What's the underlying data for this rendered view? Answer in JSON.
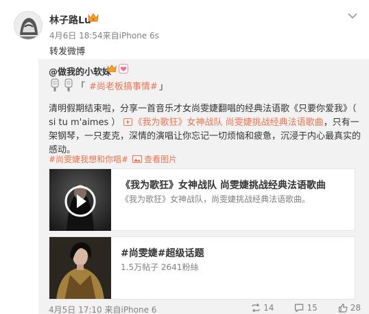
{
  "post": {
    "username": "林子路Lu",
    "meta": "4月6日 18:54来自iPhone 6s",
    "text": "转发微博"
  },
  "original": {
    "author": "@做我的小软妹",
    "hashtag": "#尚老板搞事情#",
    "bracket_open": "「",
    "bracket_close": "」",
    "body_part1": "清明假期结束啦，分享一首音乐才女尚雯婕翻唱的经典法语歌《只要你爱我》（ si tu m'aimes ）",
    "video_link": "《我为歌狂》女神战队 尚雯婕挑战经典法语歌曲",
    "body_part2": "，只有一架钢琴，一只麦克，深情的演唱让你忘记一切烦恼和疲惫，沉浸于内心最真实的感动。",
    "topic": "#尚雯婕我想和你唱#",
    "pic_link": "查看图片",
    "meta": "4月5日 17:10 来自iPhone 6",
    "actions": {
      "repost": "14",
      "comment": "15",
      "like": "28"
    }
  },
  "cards": [
    {
      "title": "《我为歌狂》女神战队 尚雯婕挑战经典法语歌曲",
      "desc": "《我为歌狂》女神战队，尚雯婕挑战经典法语歌曲。"
    },
    {
      "title": "#尚雯婕#超级话题",
      "desc": "1.5万帖子 2641粉絲"
    }
  ],
  "colors": {
    "link": "#eb7350",
    "quote_bg": "#f2f2f2",
    "meta": "#808080"
  }
}
